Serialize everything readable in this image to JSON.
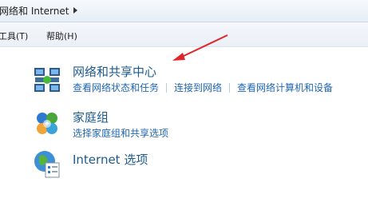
{
  "address": {
    "path_item": "网络和 Internet"
  },
  "menu": {
    "tools": "工具(T)",
    "help": "帮助(H)"
  },
  "categories": [
    {
      "title": "网络和共享中心",
      "icon": "network-sharing-center-icon",
      "links": [
        "查看网络状态和任务",
        "连接到网络",
        "查看网络计算机和设备"
      ]
    },
    {
      "title": "家庭组",
      "icon": "homegroup-icon",
      "links": [
        "选择家庭组和共享选项"
      ]
    },
    {
      "title": "Internet 选项",
      "icon": "internet-options-icon",
      "links": []
    }
  ],
  "colors": {
    "title": "#1d5a8f",
    "link": "#1f66b4",
    "annotation_arrow": "#e0262a"
  }
}
